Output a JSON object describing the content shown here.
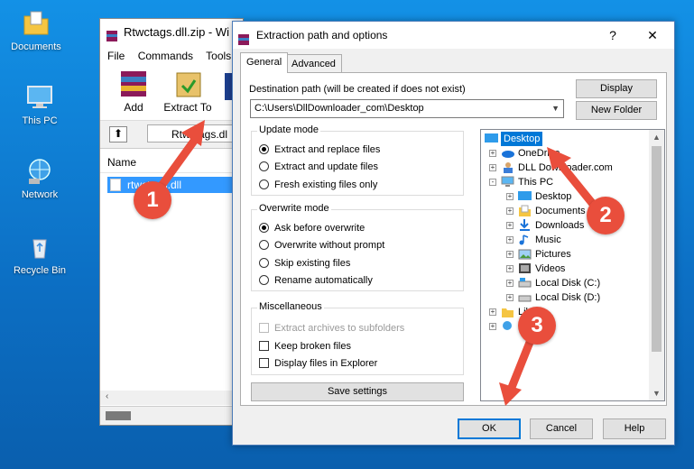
{
  "desktop": {
    "icons": [
      {
        "label": "Documents",
        "icon": "folder-icon"
      },
      {
        "label": "This PC",
        "icon": "computer-icon"
      },
      {
        "label": "Network",
        "icon": "network-icon"
      },
      {
        "label": "Recycle Bin",
        "icon": "recycle-bin-icon"
      }
    ]
  },
  "winrar": {
    "title": "Rtwctags.dll.zip - Wi",
    "menu": [
      "File",
      "Commands",
      "Tools"
    ],
    "toolbar": [
      {
        "label": "Add",
        "icon": "add-archive-icon"
      },
      {
        "label": "Extract To",
        "icon": "extract-to-icon"
      }
    ],
    "path_text": "Rtwctags.dl",
    "column_name": "Name",
    "selected_file": "rtwctags.dll"
  },
  "dialog": {
    "title": "Extraction path and options",
    "help_btn": "?",
    "close_btn": "✕",
    "tabs": [
      "General",
      "Advanced"
    ],
    "destination_label": "Destination path (will be created if does not exist)",
    "destination_value": "C:\\Users\\DllDownloader_com\\Desktop",
    "display_btn": "Display",
    "new_folder_btn": "New Folder",
    "update_mode": {
      "legend": "Update mode",
      "options": [
        "Extract and replace files",
        "Extract and update files",
        "Fresh existing files only"
      ],
      "selected": 0
    },
    "overwrite_mode": {
      "legend": "Overwrite mode",
      "options": [
        "Ask before overwrite",
        "Overwrite without prompt",
        "Skip existing files",
        "Rename automatically"
      ],
      "selected": 0
    },
    "misc": {
      "legend": "Miscellaneous",
      "options": [
        "Extract archives to subfolders",
        "Keep broken files",
        "Display files in Explorer"
      ]
    },
    "save_settings_btn": "Save settings",
    "tree": [
      {
        "label": "Desktop",
        "icon": "desktop-icon",
        "level": 0,
        "expander": "",
        "selected": true
      },
      {
        "label": "OneDrive",
        "icon": "onedrive-icon",
        "level": 1,
        "expander": "+"
      },
      {
        "label": "DLL Downloader.com",
        "icon": "user-icon",
        "level": 1,
        "expander": "+"
      },
      {
        "label": "This PC",
        "icon": "computer-icon",
        "level": 1,
        "expander": "-"
      },
      {
        "label": "Desktop",
        "icon": "desktop-icon",
        "level": 2,
        "expander": "+"
      },
      {
        "label": "Documents",
        "icon": "documents-icon",
        "level": 2,
        "expander": "+"
      },
      {
        "label": "Downloads",
        "icon": "downloads-icon",
        "level": 2,
        "expander": "+"
      },
      {
        "label": "Music",
        "icon": "music-icon",
        "level": 2,
        "expander": "+"
      },
      {
        "label": "Pictures",
        "icon": "pictures-icon",
        "level": 2,
        "expander": "+"
      },
      {
        "label": "Videos",
        "icon": "videos-icon",
        "level": 2,
        "expander": "+"
      },
      {
        "label": "Local Disk (C:)",
        "icon": "drive-icon",
        "level": 2,
        "expander": "+"
      },
      {
        "label": "Local Disk (D:)",
        "icon": "drive-icon",
        "level": 2,
        "expander": "+"
      },
      {
        "label": "Libra",
        "icon": "libraries-icon",
        "level": 1,
        "expander": "+"
      },
      {
        "label": "Ne",
        "icon": "network-icon",
        "level": 1,
        "expander": "+"
      }
    ],
    "ok_btn": "OK",
    "cancel_btn": "Cancel",
    "help_btn_bottom": "Help"
  },
  "annotations": [
    "1",
    "2",
    "3"
  ],
  "colors": {
    "arrow": "#e94e3c",
    "selection": "#0078d7",
    "desktop": "#0c6fc4"
  }
}
